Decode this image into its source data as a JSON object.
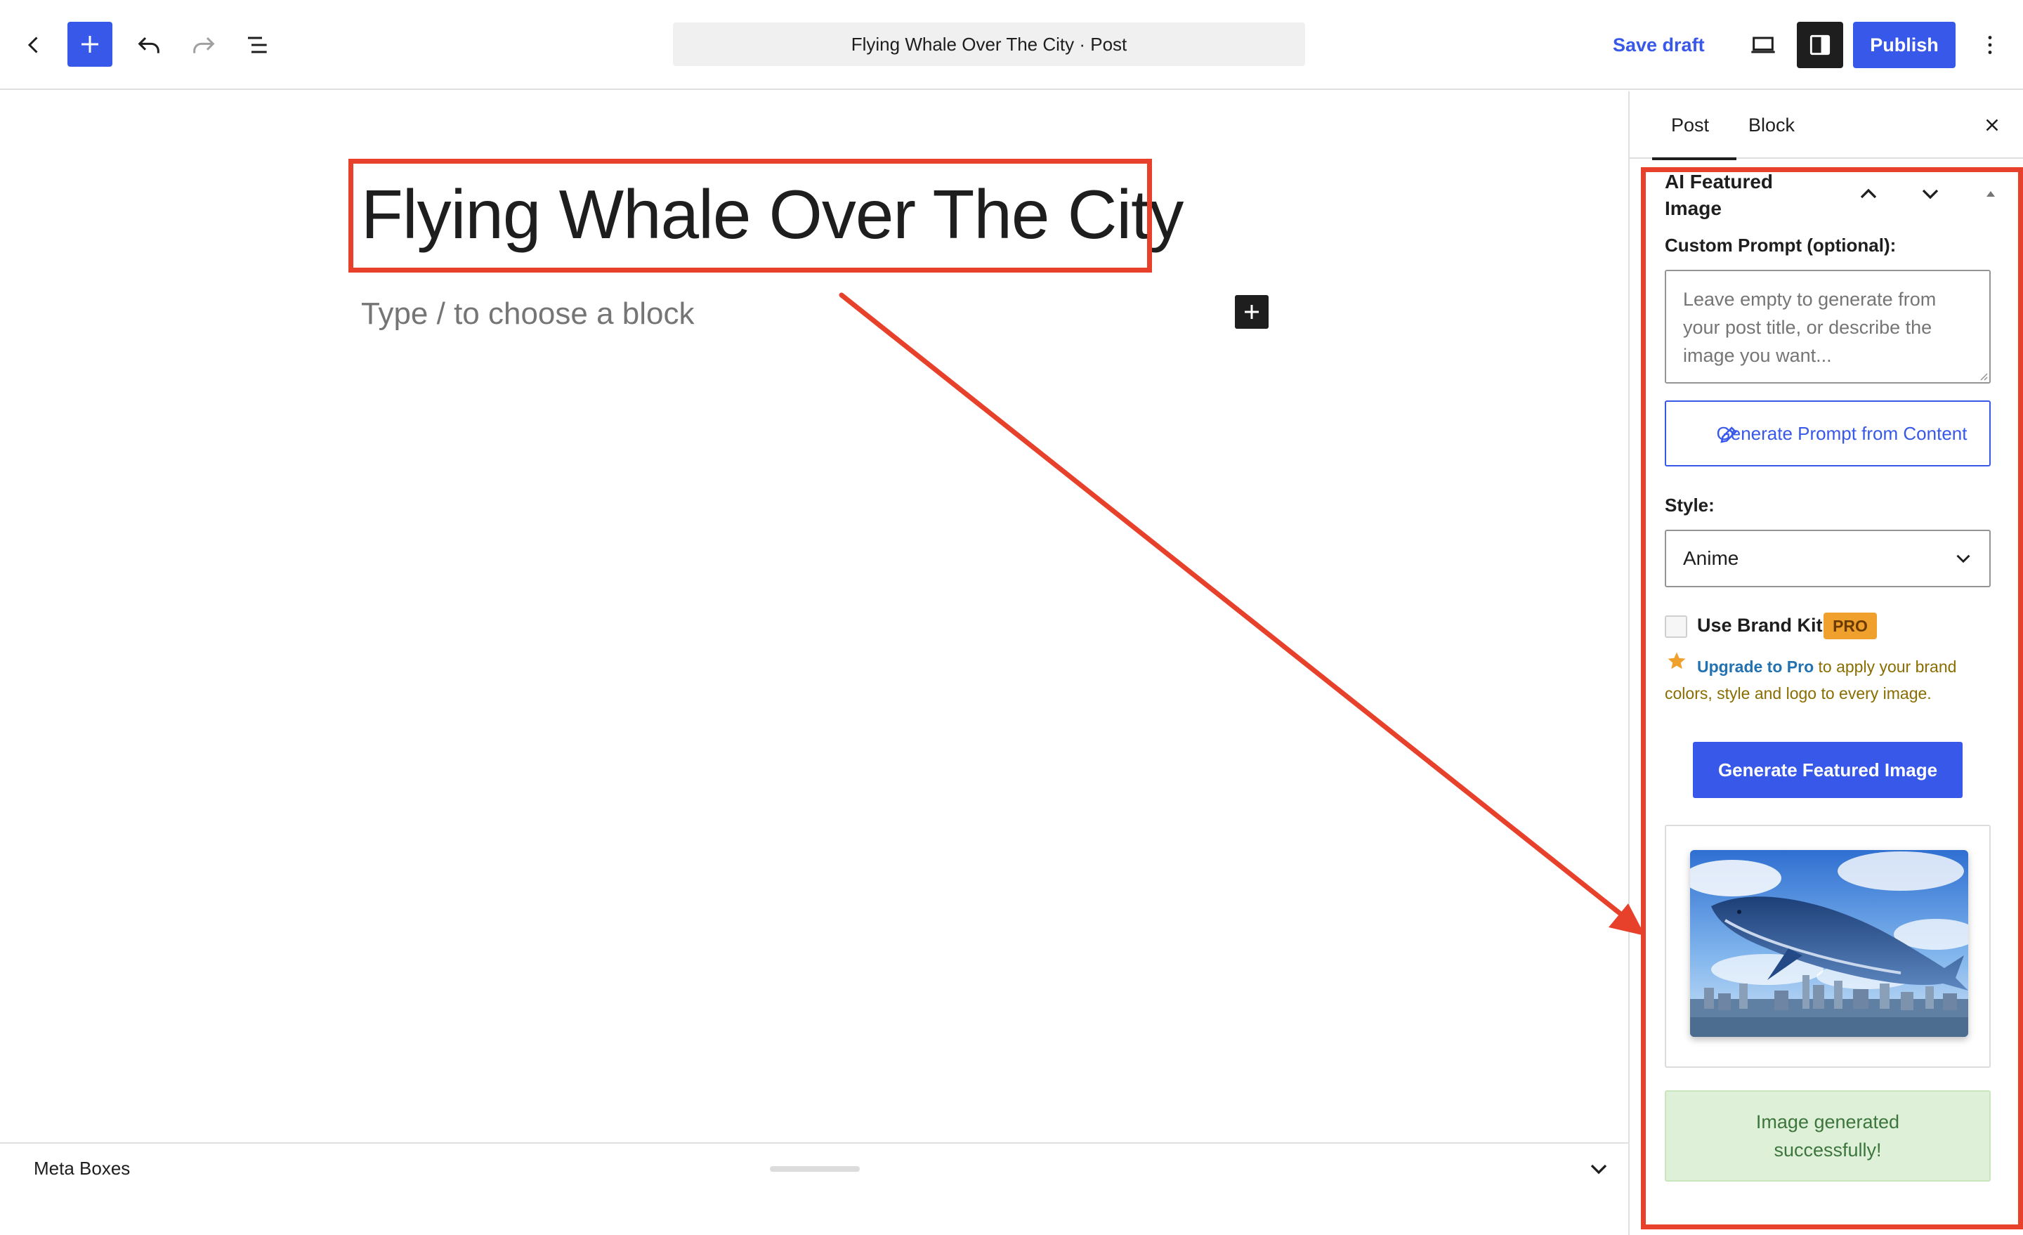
{
  "toolbar": {
    "document_title": "Flying Whale Over The City · Post",
    "save_draft_label": "Save draft",
    "publish_label": "Publish"
  },
  "editor": {
    "post_title": "Flying Whale Over The City",
    "block_placeholder": "Type / to choose a block"
  },
  "meta_boxes": {
    "label": "Meta Boxes"
  },
  "sidebar": {
    "tabs": [
      {
        "label": "Post",
        "active": true
      },
      {
        "label": "Block",
        "active": false
      }
    ],
    "panel": {
      "title": "AI Featured Image",
      "prompt_label": "Custom Prompt (optional):",
      "prompt_placeholder": "Leave empty to generate from your post title, or describe the image you want...",
      "generate_prompt_label": "Generate Prompt from Content",
      "style_label": "Style:",
      "style_value": "Anime",
      "brand_kit_label": "Use Brand Kit",
      "brand_kit_checked": false,
      "pro_badge": "PRO",
      "upgrade_link": "Upgrade to Pro",
      "upgrade_rest": " to apply your brand colors, style and logo to every image.",
      "generate_image_label": "Generate Featured Image",
      "success_message": "Image generated successfully!"
    }
  },
  "colors": {
    "accent": "#3858e9",
    "annotation": "#e8412b",
    "pro_badge": "#f0a02c",
    "success_bg": "#dff0d8"
  },
  "icons": [
    "chevron-left-icon",
    "plus-icon",
    "undo-icon",
    "redo-icon",
    "list-view-icon",
    "desktop-preview-icon",
    "sidebar-settings-icon",
    "more-vertical-icon",
    "close-icon",
    "chevron-up-icon",
    "chevron-down-icon",
    "caret-up-icon",
    "pencil-icon",
    "star-icon"
  ]
}
